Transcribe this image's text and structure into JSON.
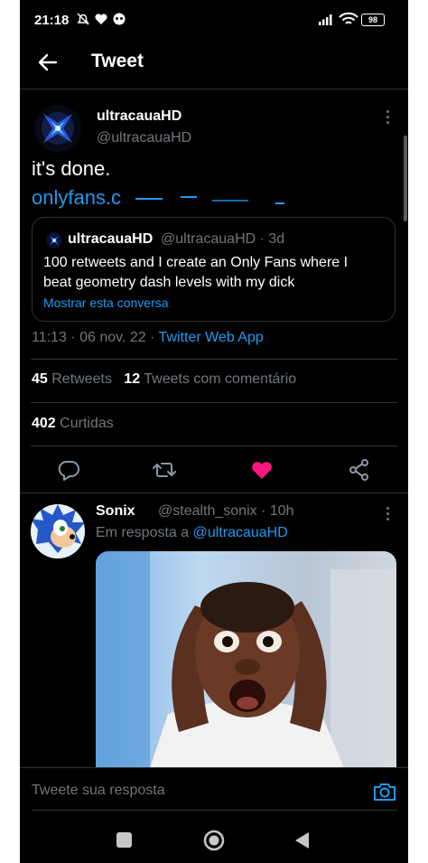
{
  "status_bar": {
    "time": "21:18",
    "battery": "98"
  },
  "header": {
    "title": "Tweet"
  },
  "tweet": {
    "author_name": "ultracauaHD",
    "author_handle": "@ultracauaHD",
    "text": "it's done.",
    "link": "onlyfans.c",
    "quote": {
      "name": "ultracauaHD",
      "handle_time": "@ultracauaHD · 3d",
      "text": "100 retweets and I create an Only Fans where I beat geometry dash levels with my dick",
      "show_thread": "Mostrar esta conversa"
    },
    "date": "11:13 · 06 nov. 22 · ",
    "source": "Twitter Web App",
    "retweets_count": "45",
    "retweets_label": "Retweets",
    "quotes_count": "12",
    "quotes_label": "Tweets com comentário",
    "likes_count": "402",
    "likes_label": "Curtidas",
    "colors": {
      "like": "#f91880",
      "link": "#1d9bf0"
    }
  },
  "reply": {
    "name": "Sonix",
    "handle_time": "@stealth_sonix · 10h",
    "reply_prefix": "Em resposta a ",
    "reply_to": "@ultracauaHD"
  },
  "composer": {
    "placeholder": "Tweete sua resposta"
  },
  "icons": [
    "back-arrow-icon",
    "more-icon",
    "reply-icon",
    "retweet-icon",
    "heart-icon",
    "share-icon",
    "camera-icon",
    "nav-recents-icon",
    "nav-home-icon",
    "nav-back-icon"
  ]
}
